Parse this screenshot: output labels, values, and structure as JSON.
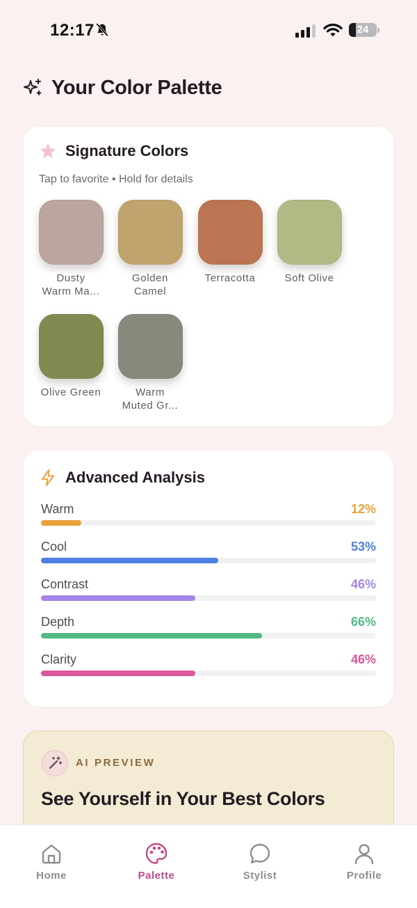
{
  "status_bar": {
    "time": "12:17",
    "battery_level": "24",
    "icons": [
      "bell-slash-icon",
      "signal-icon",
      "wifi-icon",
      "battery-icon"
    ]
  },
  "header": {
    "title": "Your Color Palette",
    "icon": "sparkles-icon"
  },
  "signature": {
    "title": "Signature Colors",
    "icon": "star-icon",
    "subtitle": "Tap to favorite • Hold for details",
    "swatches": [
      {
        "line1": "Dusty",
        "line2": "Warm Ma...",
        "color": "#bba59f"
      },
      {
        "line1": "Golden",
        "line2": "Camel",
        "color": "#c0a46d"
      },
      {
        "line1": "Terracotta",
        "line2": "",
        "color": "#bb7552"
      },
      {
        "line1": "Soft Olive",
        "line2": "",
        "color": "#b1b985"
      },
      {
        "line1": "Olive Green",
        "line2": "",
        "color": "#7f8b51"
      },
      {
        "line1": "Warm",
        "line2": "Muted Gr...",
        "color": "#868a7d"
      }
    ]
  },
  "analysis": {
    "title": "Advanced Analysis",
    "icon": "lightning-icon",
    "metrics": [
      {
        "label": "Warm",
        "value": "12%",
        "percent": 12,
        "color": "#e9a23a"
      },
      {
        "label": "Cool",
        "value": "53%",
        "percent": 53,
        "color": "#4d7ee0"
      },
      {
        "label": "Contrast",
        "value": "46%",
        "percent": 46,
        "color": "#a586e6"
      },
      {
        "label": "Depth",
        "value": "66%",
        "percent": 66,
        "color": "#52b984"
      },
      {
        "label": "Clarity",
        "value": "46%",
        "percent": 46,
        "color": "#d9579a"
      }
    ]
  },
  "ai_preview": {
    "label": "AI PREVIEW",
    "icon": "magic-wand-icon",
    "title": "See Yourself in Your Best Colors"
  },
  "tabs": [
    {
      "label": "Home",
      "icon": "home-icon",
      "active": false
    },
    {
      "label": "Palette",
      "icon": "palette-icon",
      "active": true
    },
    {
      "label": "Stylist",
      "icon": "chat-bubble-icon",
      "active": false
    },
    {
      "label": "Profile",
      "icon": "person-icon",
      "active": false
    }
  ],
  "colors": {
    "background": "#fbf1f1",
    "accent": "#c24a86",
    "text": "#241a24"
  }
}
